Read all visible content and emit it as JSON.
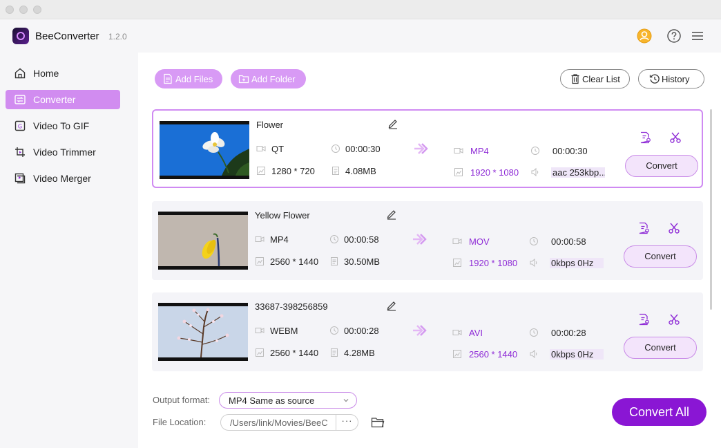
{
  "app": {
    "name": "BeeConverter",
    "version": "1.2.0"
  },
  "sidebar": {
    "items": [
      {
        "label": "Home",
        "icon": "home-icon"
      },
      {
        "label": "Converter",
        "icon": "converter-icon",
        "active": true
      },
      {
        "label": "Video To GIF",
        "icon": "gif-icon"
      },
      {
        "label": "Video Trimmer",
        "icon": "trimmer-icon"
      },
      {
        "label": "Video Merger",
        "icon": "merger-icon"
      }
    ]
  },
  "toolbar": {
    "add_files": "Add Files",
    "add_folder": "Add Folder",
    "clear_list": "Clear List",
    "history": "History"
  },
  "files": [
    {
      "name": "Flower",
      "source": {
        "format": "QT",
        "duration": "00:00:30",
        "resolution": "1280 * 720",
        "size": "4.08MB"
      },
      "output": {
        "format": "MP4",
        "duration": "00:00:30",
        "resolution": "1920 * 1080",
        "audio": "aac 253kbp..."
      },
      "convert_label": "Convert",
      "selected": true
    },
    {
      "name": "Yellow Flower",
      "source": {
        "format": "MP4",
        "duration": "00:00:58",
        "resolution": "2560 * 1440",
        "size": "30.50MB"
      },
      "output": {
        "format": "MOV",
        "duration": "00:00:58",
        "resolution": "1920 * 1080",
        "audio": "0kbps 0Hz"
      },
      "convert_label": "Convert",
      "selected": false
    },
    {
      "name": "33687-398256859",
      "source": {
        "format": "WEBM",
        "duration": "00:00:28",
        "resolution": "2560 * 1440",
        "size": "4.28MB"
      },
      "output": {
        "format": "AVI",
        "duration": "00:00:28",
        "resolution": "2560 * 1440",
        "audio": "0kbps 0Hz"
      },
      "convert_label": "Convert",
      "selected": false
    }
  ],
  "footer": {
    "output_format_label": "Output format:",
    "output_format_value": "MP4 Same as source",
    "file_location_label": "File Location:",
    "file_location_value": "/Users/link/Movies/BeeC",
    "more_label": "···",
    "convert_all": "Convert All"
  },
  "colors": {
    "accent": "#8a16d4",
    "accent_light": "#d89af5",
    "selected_border": "#cf8af2"
  }
}
